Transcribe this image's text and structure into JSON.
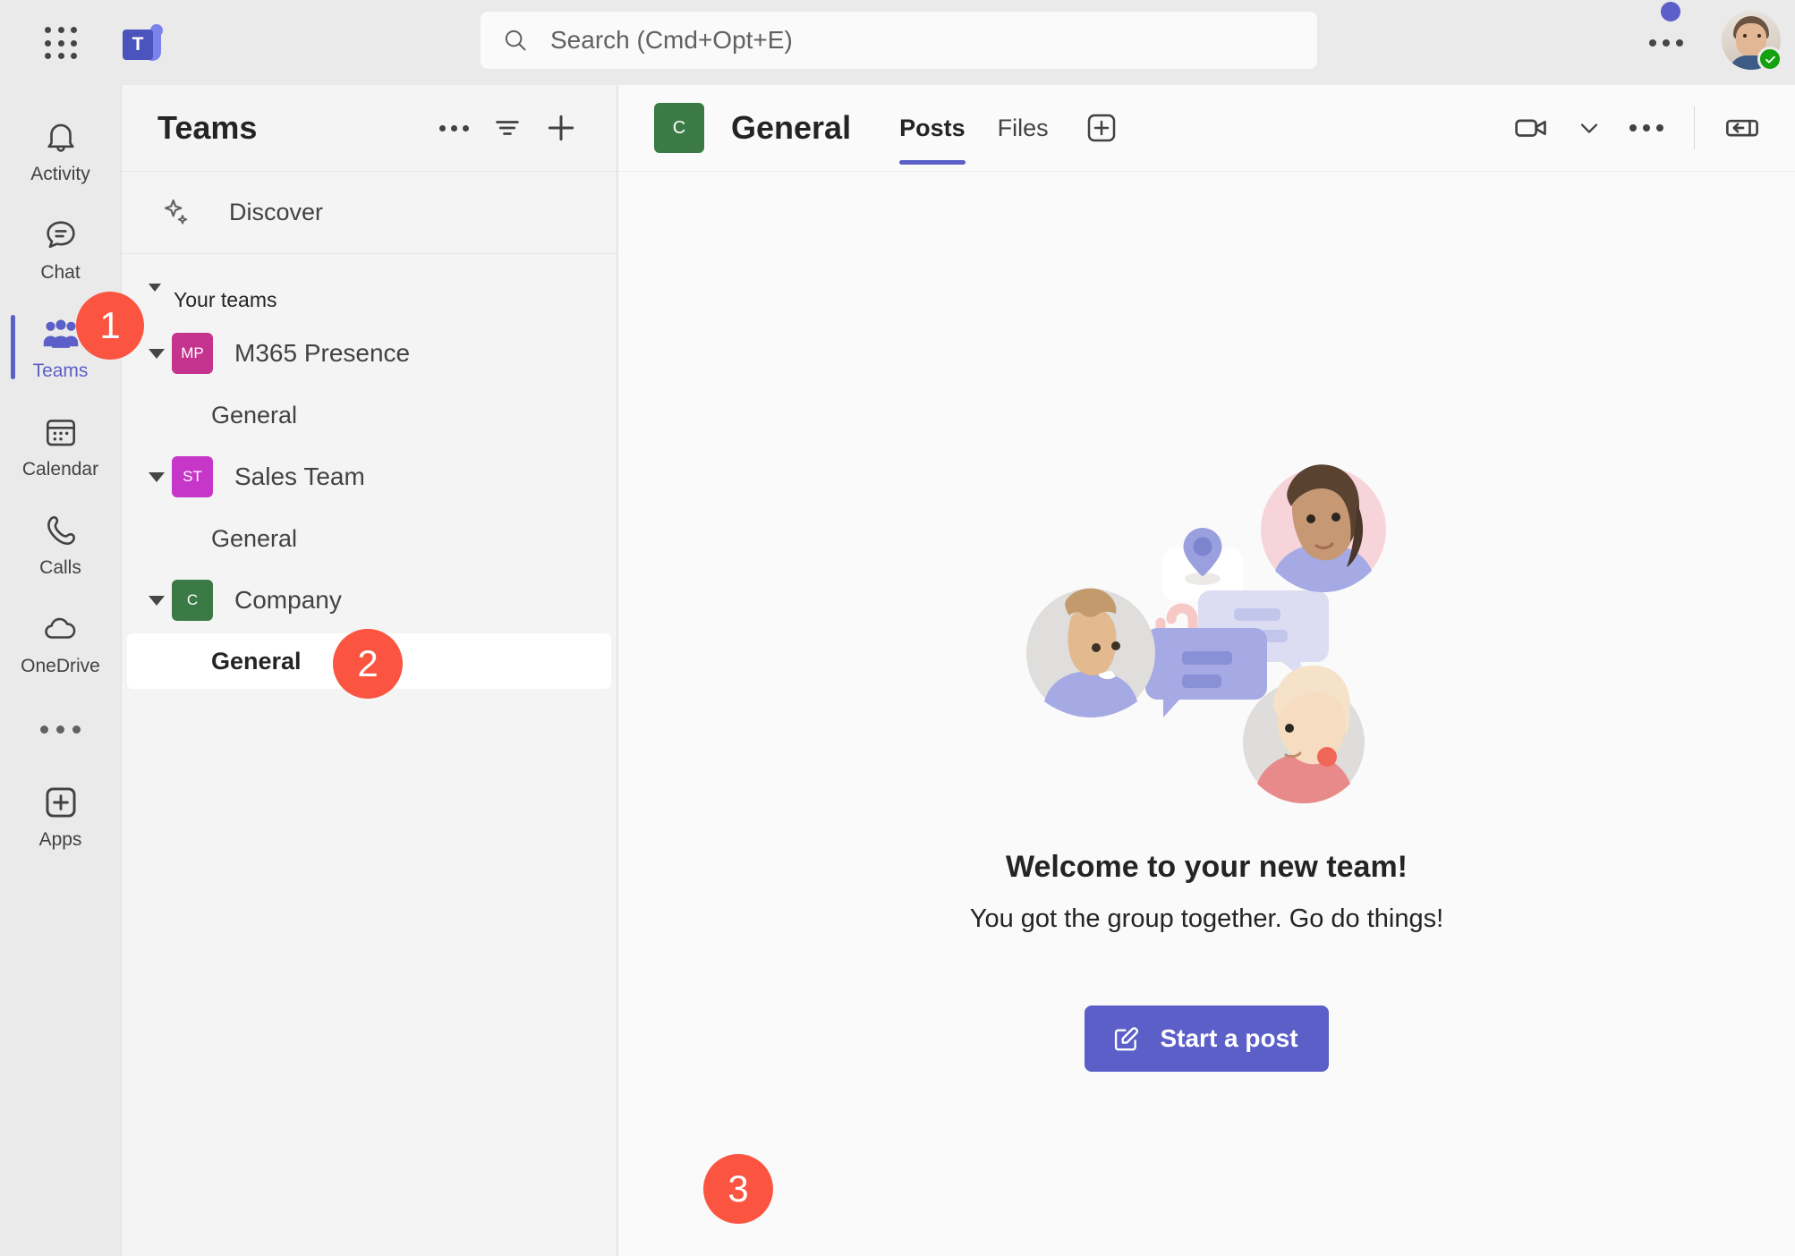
{
  "topbar": {
    "waffle_icon": "app-grid-icon",
    "logo_letter": "T",
    "search": {
      "placeholder": "Search (Cmd+Opt+E)",
      "icon": "search-icon",
      "value": ""
    },
    "more_icon": "more-horizontal-icon",
    "avatar_status": "available"
  },
  "rail": {
    "items": [
      {
        "label": "Activity",
        "icon": "bell-icon",
        "active": false
      },
      {
        "label": "Chat",
        "icon": "chat-bubble-icon",
        "active": false
      },
      {
        "label": "Teams",
        "icon": "people-icon",
        "active": true
      },
      {
        "label": "Calendar",
        "icon": "calendar-icon",
        "active": false
      },
      {
        "label": "Calls",
        "icon": "phone-icon",
        "active": false
      },
      {
        "label": "OneDrive",
        "icon": "cloud-icon",
        "active": false
      }
    ],
    "more_icon": "more-horizontal-icon",
    "apps": {
      "label": "Apps",
      "icon": "plus-box-icon"
    }
  },
  "panel": {
    "title": "Teams",
    "more_icon": "more-horizontal-icon",
    "filter_icon": "filter-icon",
    "add_icon": "plus-icon",
    "discover": {
      "label": "Discover",
      "icon": "sparkle-icon"
    },
    "your_teams_label": "Your teams",
    "teams": [
      {
        "initials": "MP",
        "name": "M365 Presence",
        "color": "#C4338D",
        "channels": [
          {
            "name": "General",
            "selected": false
          }
        ]
      },
      {
        "initials": "ST",
        "name": "Sales Team",
        "color": "#C637C9",
        "channels": [
          {
            "name": "General",
            "selected": false
          }
        ]
      },
      {
        "initials": "C",
        "name": "Company",
        "color": "#3B7A45",
        "channels": [
          {
            "name": "General",
            "selected": true
          }
        ]
      }
    ]
  },
  "main": {
    "channel_initial": "C",
    "channel_title": "General",
    "tabs": [
      {
        "label": "Posts",
        "active": true
      },
      {
        "label": "Files",
        "active": false
      }
    ],
    "add_tab_icon": "plus-box-icon",
    "meet_icon": "video-camera-icon",
    "meet_chevron_icon": "chevron-down-icon",
    "more_icon": "more-horizontal-icon",
    "panel_toggle_icon": "open-side-panel-icon",
    "welcome_title": "Welcome to your new team!",
    "welcome_subtitle": "You got the group together. Go do things!",
    "start_post_label": "Start a post",
    "start_post_icon": "compose-icon",
    "illustration": "people-chat-illustration"
  },
  "badges": [
    {
      "number": "1",
      "target": "rail-item-teams"
    },
    {
      "number": "2",
      "target": "channel-general-company"
    },
    {
      "number": "3",
      "target": "start-a-post-button"
    }
  ],
  "colors": {
    "accent": "#5B5FC7",
    "badge": "#FB5441",
    "status_available": "#13A10E",
    "topbar_bg": "#EAEAEA",
    "panel_bg": "#F4F4F4",
    "main_bg": "#FAFAFA"
  }
}
